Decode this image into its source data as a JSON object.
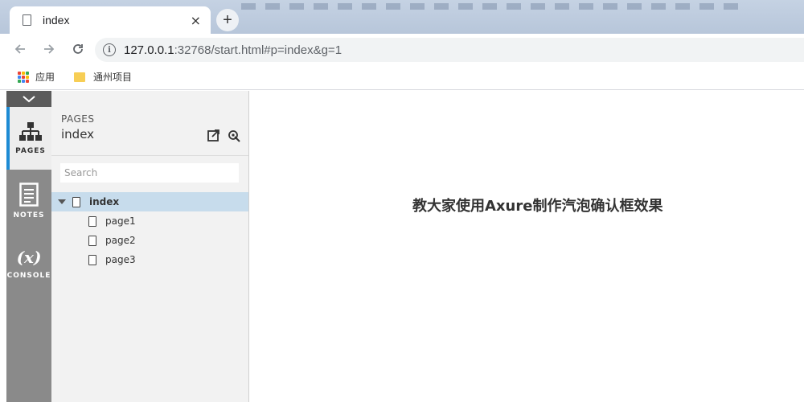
{
  "browser": {
    "tab": {
      "title": "index",
      "close_glyph": "×"
    },
    "new_tab_glyph": "+",
    "address": {
      "host": "127.0.0.1",
      "rest": ":32768/start.html#p=index&g=1"
    },
    "bookmarks": [
      {
        "label": "应用",
        "icon": "apps-grid-icon"
      },
      {
        "label": "通州项目",
        "icon": "folder-icon"
      }
    ],
    "apps_colors": [
      "#ea4335",
      "#fbbc05",
      "#34a853",
      "#4285f4",
      "#ea4335",
      "#fbbc05",
      "#34a853",
      "#4285f4",
      "#ea4335"
    ]
  },
  "rail": {
    "items": [
      {
        "label": "PAGES",
        "icon": "sitemap-icon",
        "active": true
      },
      {
        "label": "NOTES",
        "icon": "notes-icon",
        "active": false
      },
      {
        "label": "CONSOLE",
        "icon": "variable-x-icon",
        "glyph": "(x)",
        "active": false
      }
    ],
    "accent": "#1e8bd4"
  },
  "pages_panel": {
    "caption": "PAGES",
    "current": "index",
    "search_placeholder": "Search",
    "tree": {
      "root": "index",
      "children": [
        "page1",
        "page2",
        "page3"
      ]
    }
  },
  "canvas": {
    "heading": "教大家使用Axure制作汽泡确认框效果"
  }
}
